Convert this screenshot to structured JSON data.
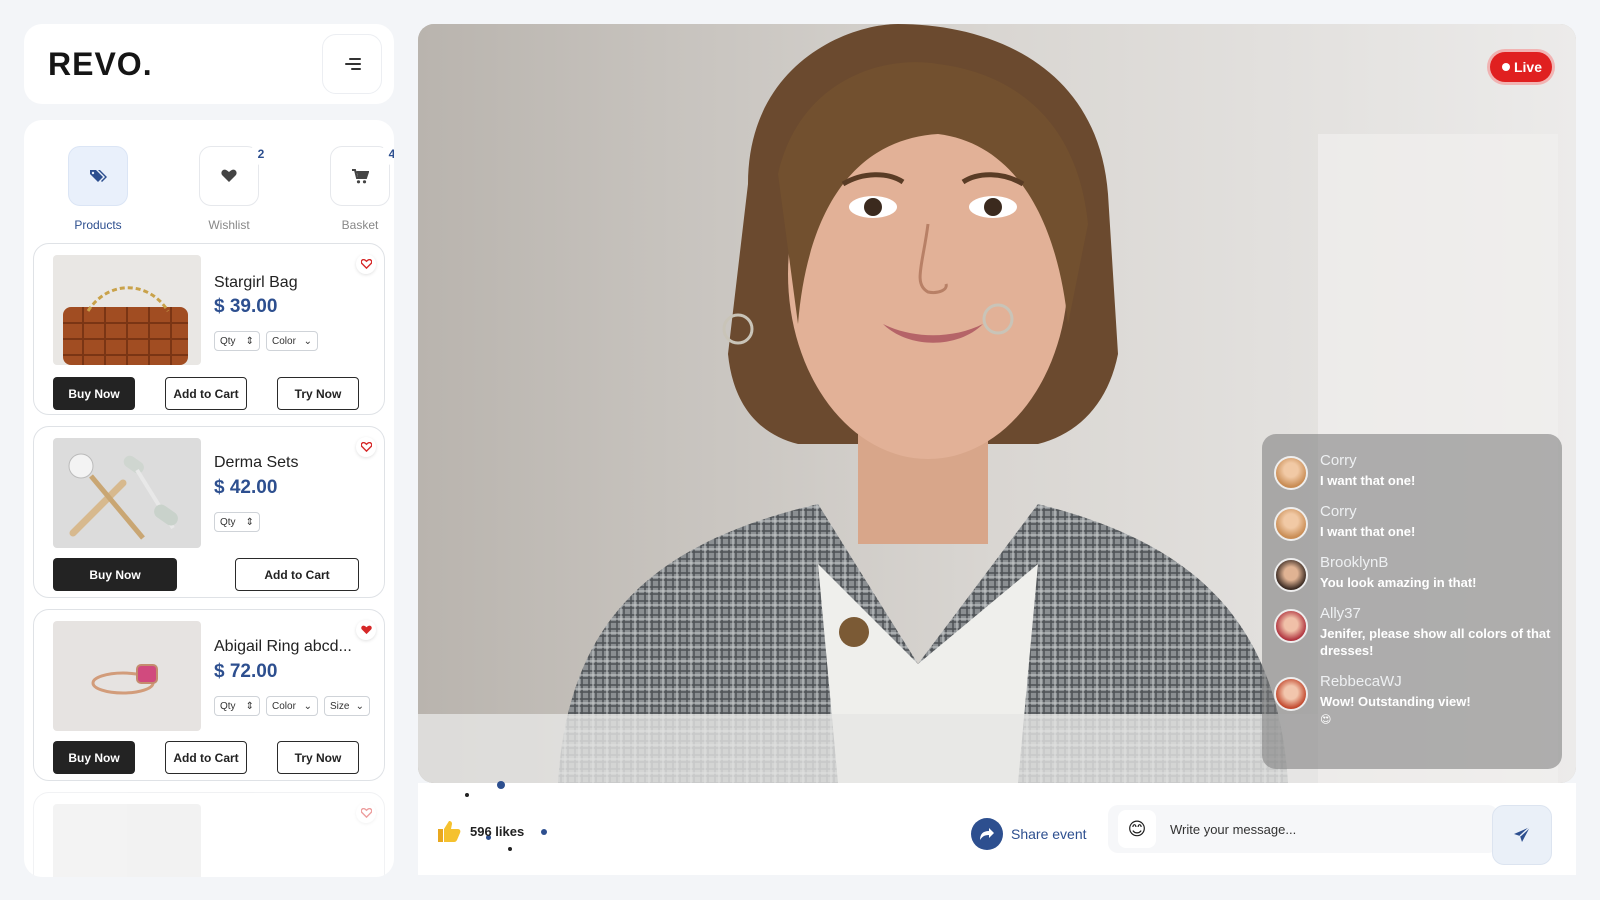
{
  "app": {
    "logo_text": "REVO",
    "logo_dot": "."
  },
  "nav": {
    "products": {
      "label": "Products",
      "icon": "tags-icon",
      "active": true
    },
    "wishlist": {
      "label": "Wishlist",
      "icon": "heart-icon",
      "count": "2"
    },
    "basket": {
      "label": "Basket",
      "icon": "cart-icon",
      "count": "4"
    }
  },
  "products": [
    {
      "name": "Stargirl Bag",
      "price": "$ 39.00",
      "favorite": false,
      "selects": {
        "qty": "Qty",
        "color": "Color"
      },
      "buttons": {
        "buy": "Buy Now",
        "add": "Add to Cart",
        "try": "Try Now"
      }
    },
    {
      "name": "Derma Sets",
      "price": "$ 42.00",
      "favorite": false,
      "selects": {
        "qty": "Qty"
      },
      "buttons": {
        "buy": "Buy Now",
        "add": "Add to Cart"
      }
    },
    {
      "name": "Abigail Ring abcd...",
      "price": "$ 72.00",
      "favorite": true,
      "selects": {
        "qty": "Qty",
        "color": "Color",
        "size": "Size"
      },
      "buttons": {
        "buy": "Buy Now",
        "add": "Add to Cart",
        "try": "Try Now"
      }
    }
  ],
  "stream": {
    "live_label": "Live",
    "chat": [
      {
        "user": "Corry",
        "text": "I want that one!"
      },
      {
        "user": "Corry",
        "text": "I want that one!"
      },
      {
        "user": "BrooklynB",
        "text": "You look amazing in that!"
      },
      {
        "user": "Ally37",
        "text": "Jenifer, please show all colors of that dresses!"
      },
      {
        "user": "RebbecaWJ",
        "text": "Wow! Outstanding view!",
        "emoji": "😍"
      }
    ]
  },
  "footer": {
    "likes": "596 likes",
    "share_label": "Share event",
    "message_placeholder": "Write your message...",
    "emoji": "😊"
  },
  "colors": {
    "accent": "#2d4f8f",
    "live": "#e02020",
    "dark_button": "#232323"
  }
}
